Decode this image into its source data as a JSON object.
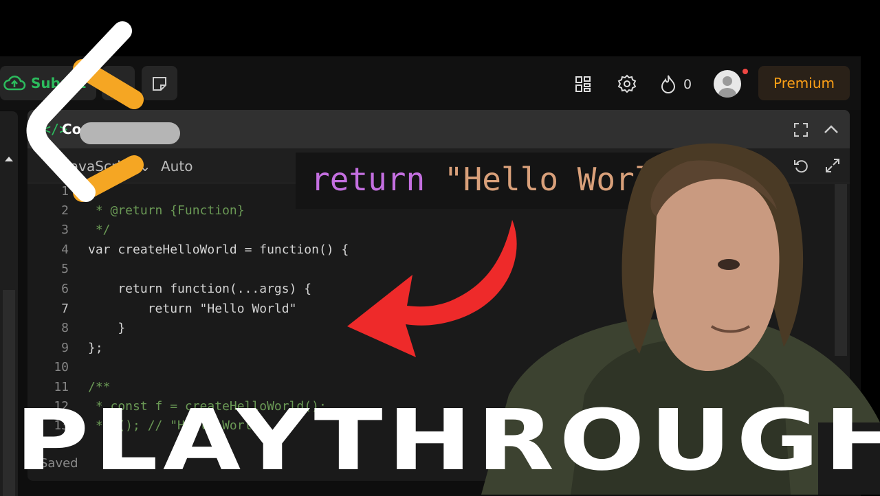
{
  "topbar": {
    "submit_label": "Submit",
    "streak_count": "0",
    "premium_label": "Premium"
  },
  "editor": {
    "title": "Code",
    "language": "JavaScript",
    "auto_label": "Auto",
    "status": "Saved",
    "code_lines": [
      {
        "num": "1",
        "text": ""
      },
      {
        "num": "2",
        "text": " * @return {Function}"
      },
      {
        "num": "3",
        "text": " */"
      },
      {
        "num": "4",
        "text": "var createHelloWorld = function() {"
      },
      {
        "num": "5",
        "text": ""
      },
      {
        "num": "6",
        "text": "    return function(...args) {"
      },
      {
        "num": "7",
        "text": "        return \"Hello World\""
      },
      {
        "num": "8",
        "text": "    }"
      },
      {
        "num": "9",
        "text": "};"
      },
      {
        "num": "10",
        "text": ""
      },
      {
        "num": "11",
        "text": "/**"
      },
      {
        "num": "12",
        "text": " * const f = createHelloWorld();"
      },
      {
        "num": "13",
        "text": " * f(); // \"Hello World\""
      }
    ]
  },
  "overlay": {
    "banner_keyword": "return",
    "banner_string": "\"Hello World\"",
    "title": "PLAYTHROUGH"
  },
  "colors": {
    "accent_green": "#2cbb5d",
    "premium_orange": "#ffa116",
    "arrow_red": "#ee2a2a",
    "logo_orange": "#f5a623"
  },
  "icons": [
    "cloud-upload-icon",
    "grid-icon",
    "gear-icon",
    "fire-icon",
    "note-icon",
    "expand-icon",
    "chevron-up-icon",
    "undo-icon",
    "fullscreen-icon",
    "leetcode-logo"
  ]
}
